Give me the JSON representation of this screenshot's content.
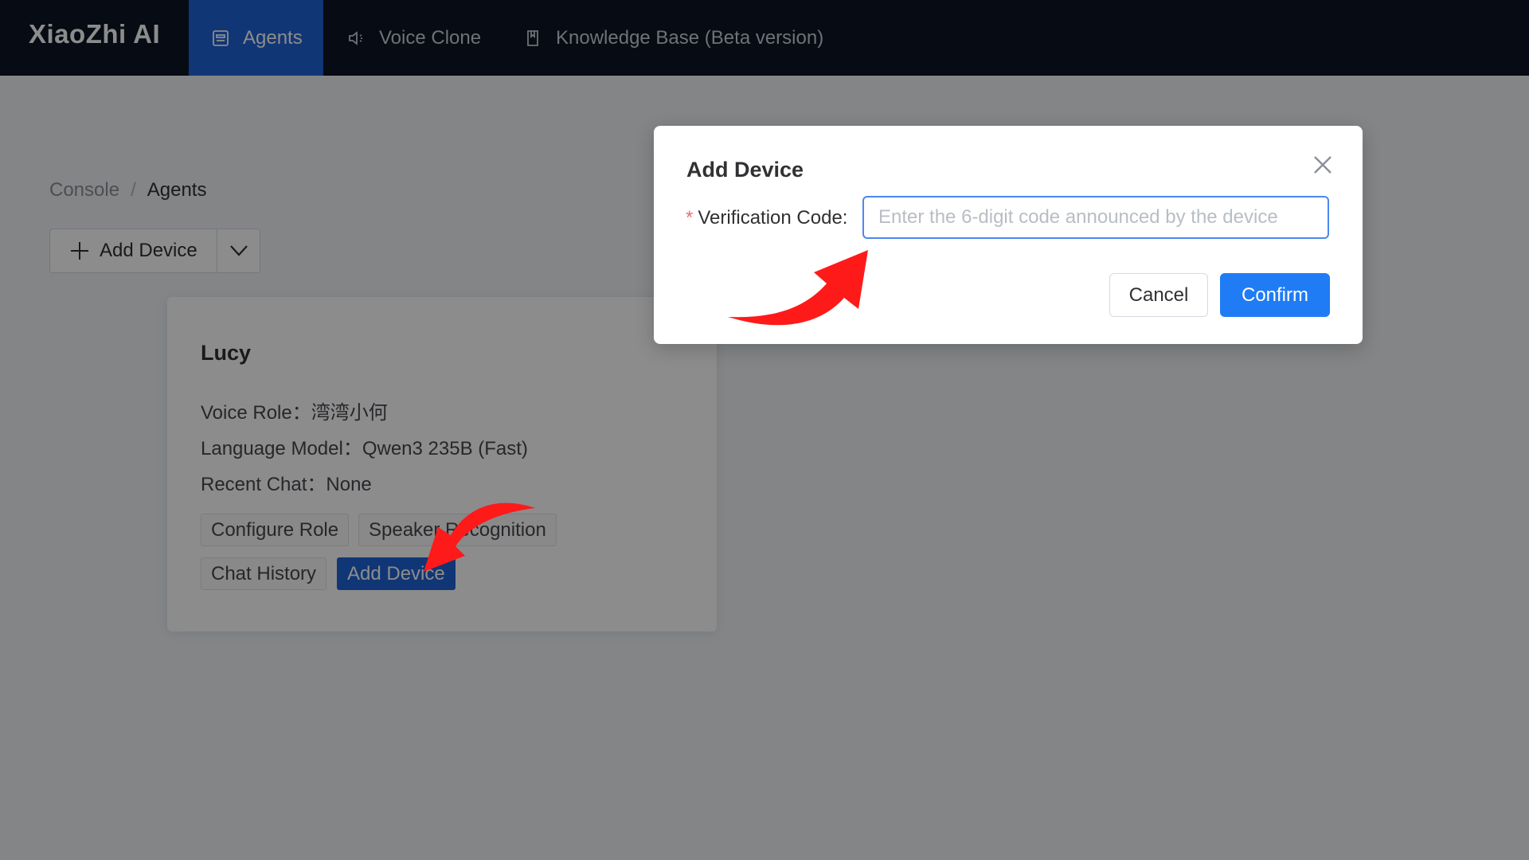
{
  "nav": {
    "brand": "XiaoZhi AI",
    "items": [
      {
        "label": "Agents",
        "icon": "agent-icon",
        "active": true
      },
      {
        "label": "Voice Clone",
        "icon": "speaker-icon",
        "active": false
      },
      {
        "label": "Knowledge Base (Beta version)",
        "icon": "book-icon",
        "active": false
      }
    ]
  },
  "breadcrumb": {
    "items": [
      "Console",
      "Agents"
    ],
    "separator": "/"
  },
  "toolbar": {
    "add_device_label": "Add Device"
  },
  "agent_card": {
    "name": "Lucy",
    "voice_role": "Voice Role：湾湾小何",
    "language_model": "Language Model：Qwen3 235B (Fast)",
    "recent_chat": "Recent Chat：None",
    "buttons": [
      "Configure Role",
      "Speaker Recognition",
      "Chat History",
      "Add Device"
    ]
  },
  "dialog": {
    "title": "Add Device",
    "field_label": "Verification Code:",
    "required_mark": "*",
    "placeholder": "Enter the 6-digit code announced by the device",
    "cancel_label": "Cancel",
    "confirm_label": "Confirm"
  },
  "colors": {
    "topbar": "#0b1526",
    "active_nav": "#1f63d6",
    "primary": "#1f7cf5",
    "annotation_arrow": "#ff1a1a"
  }
}
